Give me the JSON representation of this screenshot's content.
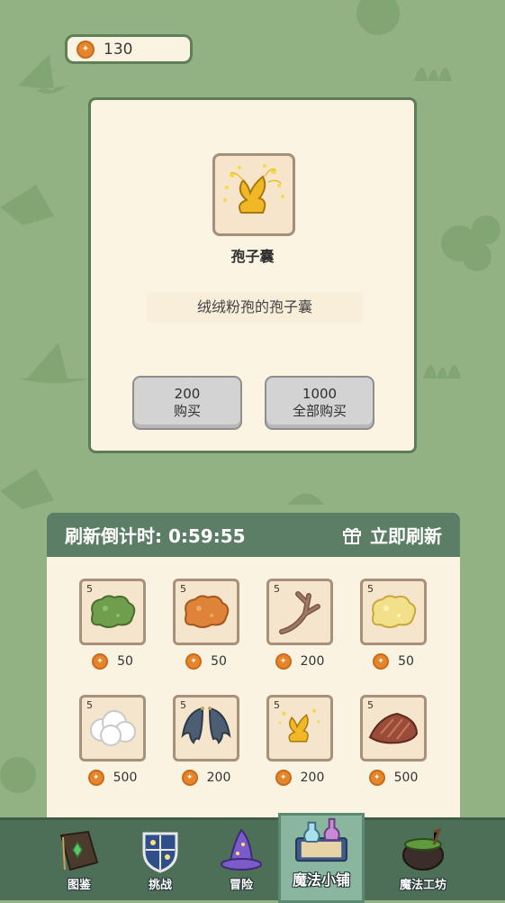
{
  "currency": {
    "icon": "coin-icon",
    "amount": "130"
  },
  "detail": {
    "item_name": "孢子囊",
    "description": "绒绒粉孢的孢子囊",
    "buy_one": {
      "price": "200",
      "label": "购买"
    },
    "buy_all": {
      "price": "1000",
      "label": "全部购买"
    }
  },
  "shop": {
    "countdown_label": "刷新倒计时: 0:59:55",
    "refresh_label": "立即刷新",
    "items": [
      {
        "name": "green-slime",
        "count": "5",
        "price": "50"
      },
      {
        "name": "orange-slime",
        "count": "5",
        "price": "50"
      },
      {
        "name": "antler-branch",
        "count": "5",
        "price": "200"
      },
      {
        "name": "yellow-slime",
        "count": "5",
        "price": "50"
      },
      {
        "name": "cotton-cloud",
        "count": "5",
        "price": "500"
      },
      {
        "name": "bat-wings",
        "count": "5",
        "price": "200"
      },
      {
        "name": "spore-sac",
        "count": "5",
        "price": "200"
      },
      {
        "name": "roast-meat",
        "count": "5",
        "price": "500"
      }
    ]
  },
  "nav": {
    "tabs": [
      {
        "label": "图鉴",
        "icon": "book-icon"
      },
      {
        "label": "挑战",
        "icon": "shield-icon"
      },
      {
        "label": "冒险",
        "icon": "wizard-hat-icon"
      },
      {
        "label": "魔法小铺",
        "icon": "magic-shop-icon",
        "active": true
      },
      {
        "label": "魔法工坊",
        "icon": "cauldron-icon"
      }
    ]
  },
  "colors": {
    "background": "#93b283",
    "panel": "#fcf4e2",
    "header": "#5c7e67",
    "coin": "#e5862f"
  }
}
